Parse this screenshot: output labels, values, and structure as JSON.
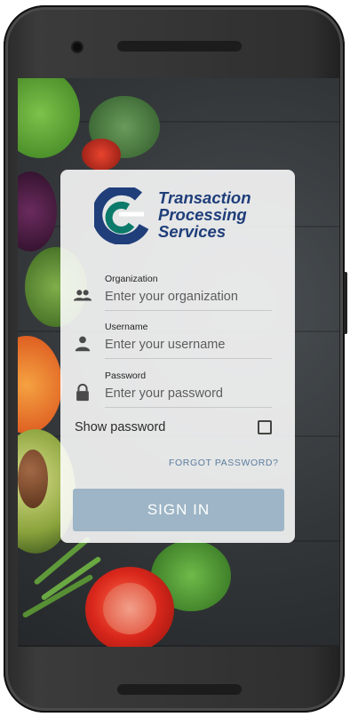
{
  "brand": {
    "line1": "Transaction",
    "line2": "Processing",
    "line3": "Services",
    "color": "#1f3e7a",
    "accent": "#0b7a6b"
  },
  "form": {
    "organization": {
      "label": "Organization",
      "placeholder": "Enter your organization",
      "icon": "group-icon"
    },
    "username": {
      "label": "Username",
      "placeholder": "Enter your username",
      "icon": "person-icon"
    },
    "password": {
      "label": "Password",
      "placeholder": "Enter your password",
      "icon": "lock-icon"
    },
    "show_password": {
      "label": "Show password",
      "checked": false
    },
    "forgot_password": "FORGOT PASSWORD?",
    "sign_in": "SIGN IN"
  },
  "colors": {
    "button": "#9db5c6",
    "link": "#5a7da0"
  }
}
